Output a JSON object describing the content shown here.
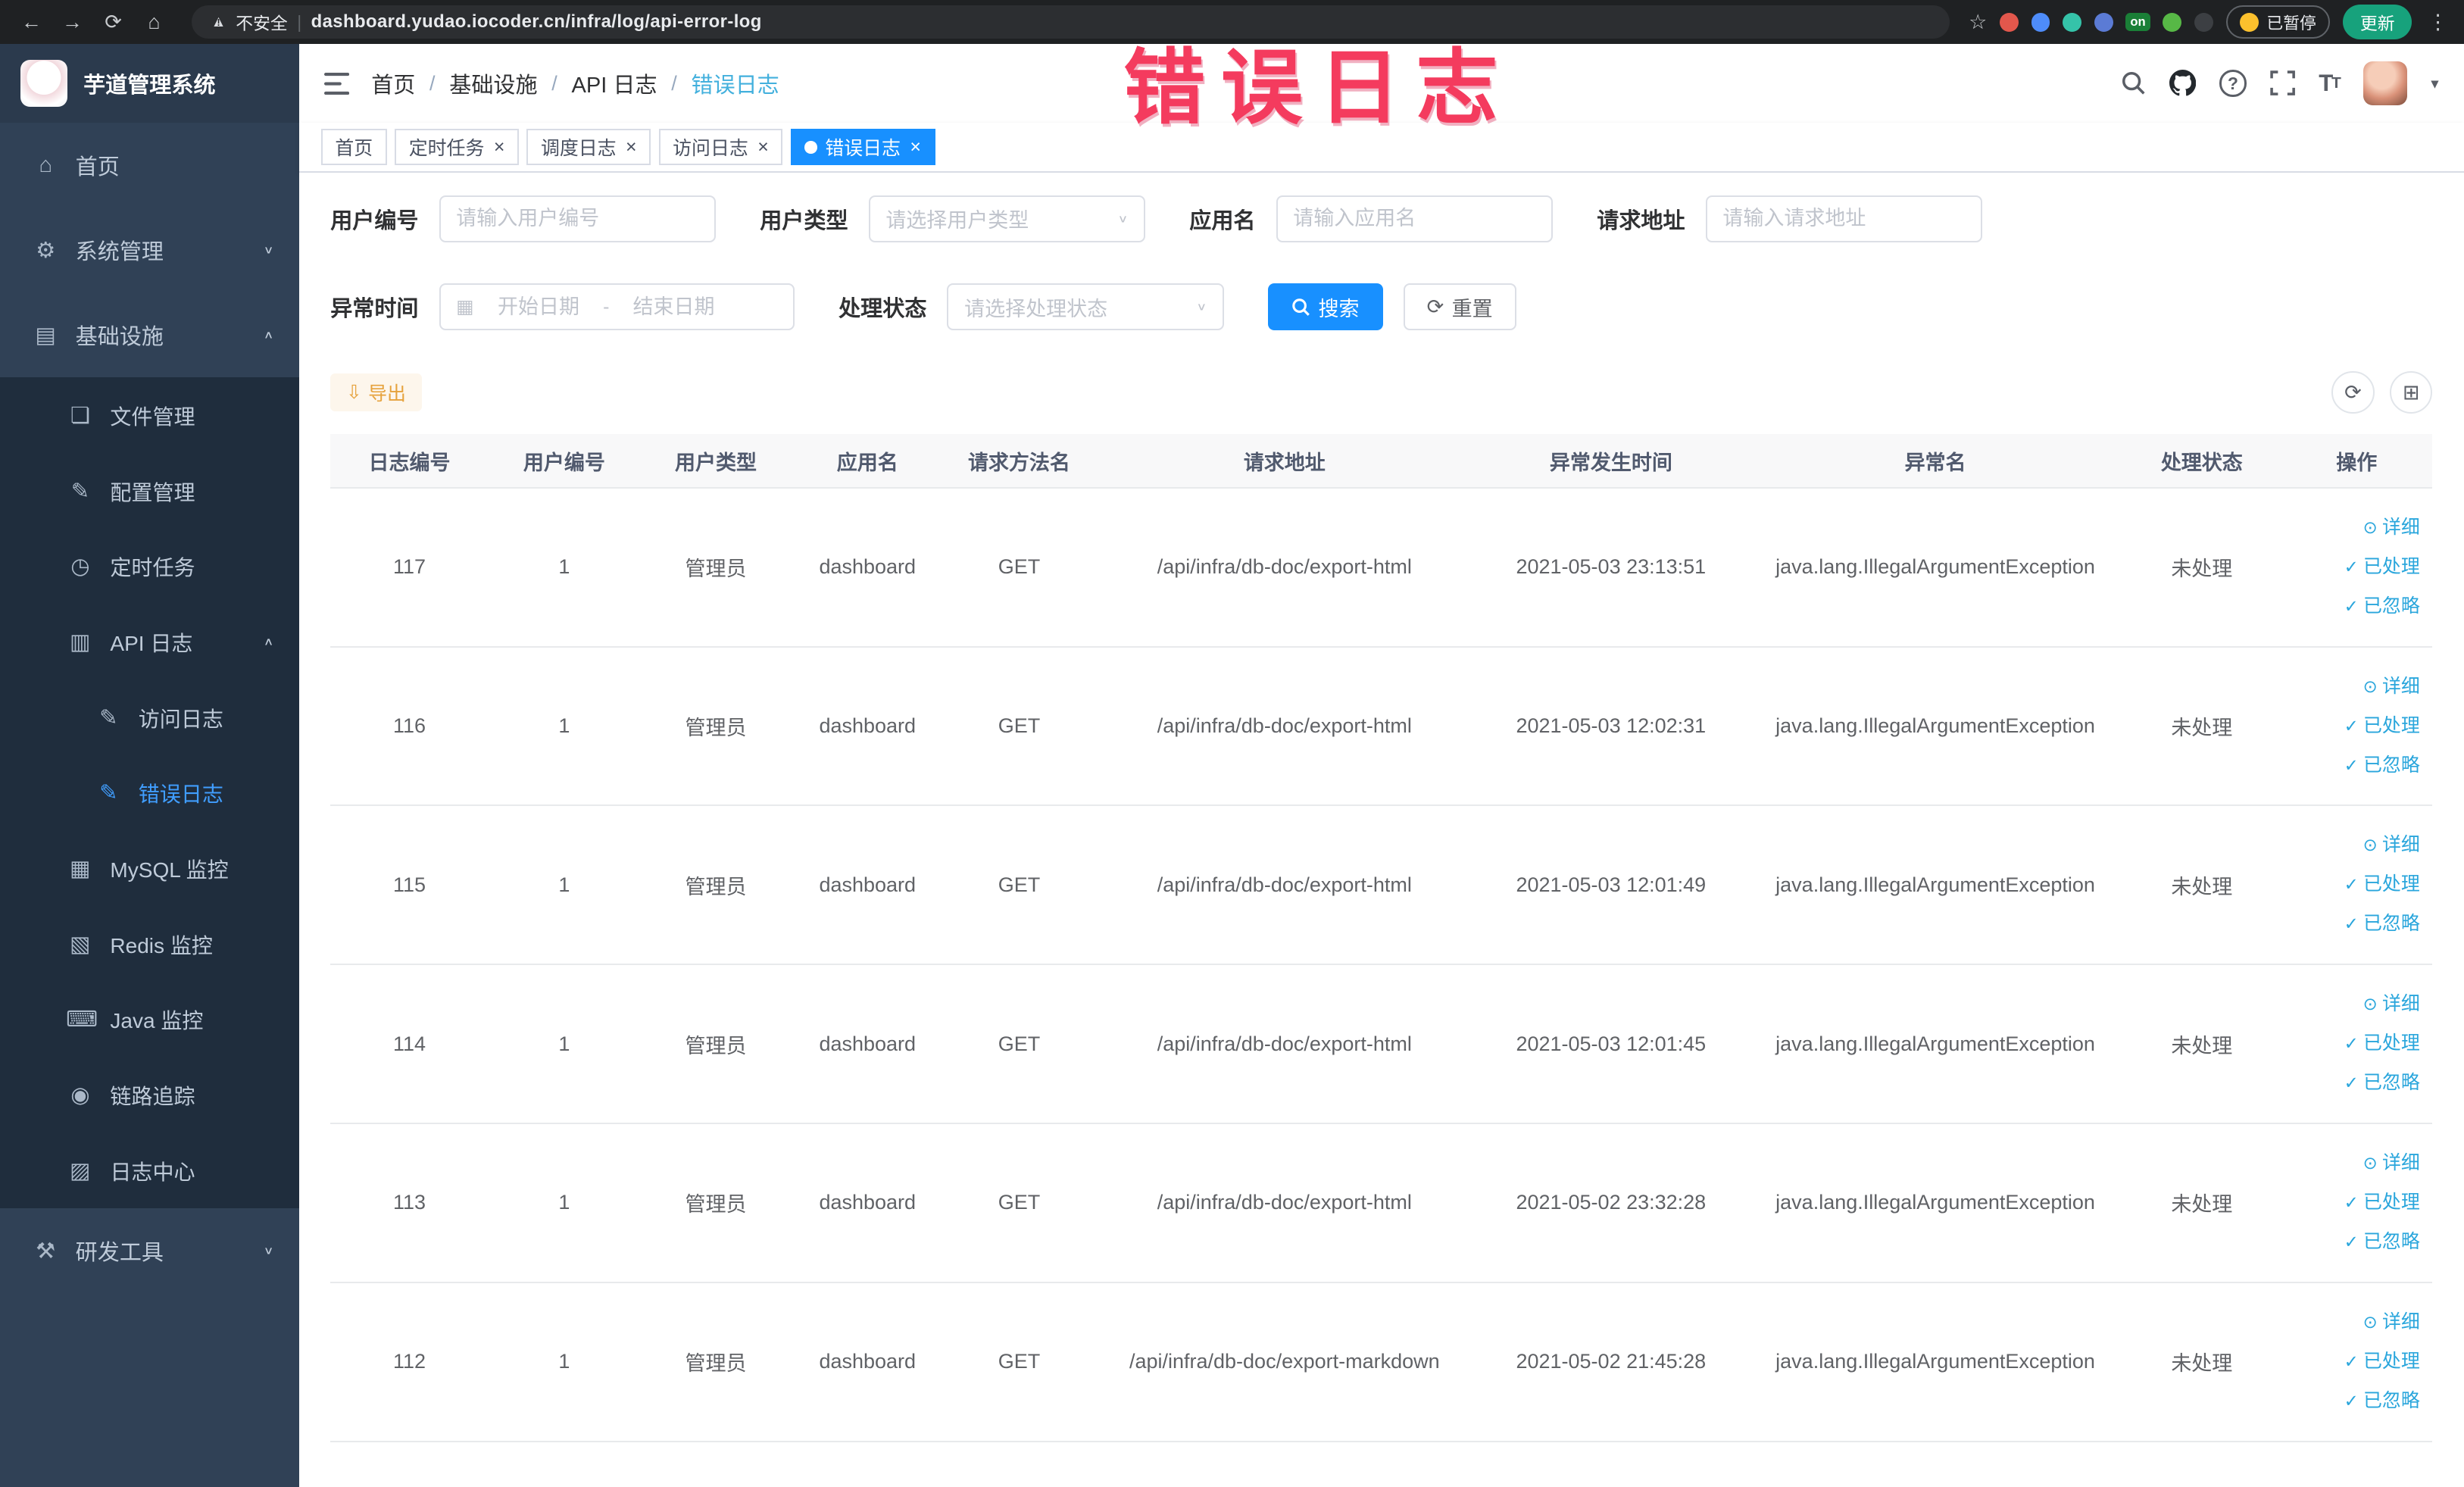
{
  "colors": {
    "primary": "#1890ff",
    "warning_button": "#e6a23c",
    "sidebar_bg": "#304156",
    "submenu_bg": "#1f2d3d",
    "sidebar_active": "#409eff",
    "link": "#2aa6dc",
    "watermark": "#f43b5e",
    "active_tab_bg": "#1890ff"
  },
  "annotation": {
    "watermark_text": "错误日志"
  },
  "browser": {
    "security_label": "不安全",
    "url": "dashboard.yudao.iocoder.cn/infra/log/api-error-log",
    "vpn_badge": "on",
    "paused_label": "已暂停",
    "update_label": "更新"
  },
  "sidebar": {
    "logo_title": "芋道管理系统",
    "items": [
      {
        "key": "home",
        "icon": "home-icon",
        "label": "首页",
        "level": 1
      },
      {
        "key": "system",
        "icon": "gear-icon",
        "label": "系统管理",
        "level": 1,
        "chevron": "down"
      },
      {
        "key": "infra",
        "icon": "infra-icon",
        "label": "基础设施",
        "level": 1,
        "chevron": "up"
      },
      {
        "key": "file",
        "icon": "file-icon",
        "label": "文件管理",
        "level": 2
      },
      {
        "key": "config",
        "icon": "config-icon",
        "label": "配置管理",
        "level": 2
      },
      {
        "key": "job",
        "icon": "timer-icon",
        "label": "定时任务",
        "level": 2
      },
      {
        "key": "api-log",
        "icon": "api-log-icon",
        "label": "API 日志",
        "level": 2,
        "chevron": "up"
      },
      {
        "key": "access-log",
        "icon": "edit-icon",
        "label": "访问日志",
        "level": 3
      },
      {
        "key": "error-log",
        "icon": "edit-icon",
        "label": "错误日志",
        "level": 3,
        "active": true
      },
      {
        "key": "mysql",
        "icon": "mysql-icon",
        "label": "MySQL 监控",
        "level": 2
      },
      {
        "key": "redis",
        "icon": "redis-icon",
        "label": "Redis 监控",
        "level": 2
      },
      {
        "key": "java",
        "icon": "java-icon",
        "label": "Java 监控",
        "level": 2
      },
      {
        "key": "trace",
        "icon": "trace-icon",
        "label": "链路追踪",
        "level": 2
      },
      {
        "key": "log-center",
        "icon": "log-center-icon",
        "label": "日志中心",
        "level": 2
      },
      {
        "key": "devtools",
        "icon": "tools-icon",
        "label": "研发工具",
        "level": 1,
        "chevron": "down"
      }
    ]
  },
  "header": {
    "breadcrumb": [
      "首页",
      "基础设施",
      "API 日志",
      "错误日志"
    ]
  },
  "tabs": [
    {
      "key": "home",
      "label": "首页",
      "closable": false,
      "active": false
    },
    {
      "key": "job",
      "label": "定时任务",
      "closable": true,
      "active": false
    },
    {
      "key": "job-log",
      "label": "调度日志",
      "closable": true,
      "active": false
    },
    {
      "key": "access-log",
      "label": "访问日志",
      "closable": true,
      "active": false
    },
    {
      "key": "error-log",
      "label": "错误日志",
      "closable": true,
      "active": true
    }
  ],
  "filters": {
    "user_id_label": "用户编号",
    "user_id_placeholder": "请输入用户编号",
    "user_type_label": "用户类型",
    "user_type_placeholder": "请选择用户类型",
    "app_name_label": "应用名",
    "app_name_placeholder": "请输入应用名",
    "request_url_label": "请求地址",
    "request_url_placeholder": "请输入请求地址",
    "time_label": "异常时间",
    "time_start_placeholder": "开始日期",
    "time_separator": "-",
    "time_end_placeholder": "结束日期",
    "status_label": "处理状态",
    "status_placeholder": "请选择处理状态",
    "search_label": "搜索",
    "reset_label": "重置"
  },
  "toolbar": {
    "export_label": "导出"
  },
  "table": {
    "headers": [
      "日志编号",
      "用户编号",
      "用户类型",
      "应用名",
      "请求方法名",
      "请求地址",
      "异常发生时间",
      "异常名",
      "处理状态",
      "操作"
    ],
    "action_labels": {
      "detail": "详细",
      "processed": "已处理",
      "ignore": "已忽略"
    },
    "rows": [
      {
        "log_id": "117",
        "user_id": "1",
        "user_type": "管理员",
        "app_name": "dashboard",
        "method": "GET",
        "request_url": "/api/infra/db-doc/export-html",
        "time": "2021-05-03 23:13:51",
        "exception": "java.lang.IllegalArgumentException",
        "status": "未处理"
      },
      {
        "log_id": "116",
        "user_id": "1",
        "user_type": "管理员",
        "app_name": "dashboard",
        "method": "GET",
        "request_url": "/api/infra/db-doc/export-html",
        "time": "2021-05-03 12:02:31",
        "exception": "java.lang.IllegalArgumentException",
        "status": "未处理"
      },
      {
        "log_id": "115",
        "user_id": "1",
        "user_type": "管理员",
        "app_name": "dashboard",
        "method": "GET",
        "request_url": "/api/infra/db-doc/export-html",
        "time": "2021-05-03 12:01:49",
        "exception": "java.lang.IllegalArgumentException",
        "status": "未处理"
      },
      {
        "log_id": "114",
        "user_id": "1",
        "user_type": "管理员",
        "app_name": "dashboard",
        "method": "GET",
        "request_url": "/api/infra/db-doc/export-html",
        "time": "2021-05-03 12:01:45",
        "exception": "java.lang.IllegalArgumentException",
        "status": "未处理"
      },
      {
        "log_id": "113",
        "user_id": "1",
        "user_type": "管理员",
        "app_name": "dashboard",
        "method": "GET",
        "request_url": "/api/infra/db-doc/export-html",
        "time": "2021-05-02 23:32:28",
        "exception": "java.lang.IllegalArgumentException",
        "status": "未处理"
      },
      {
        "log_id": "112",
        "user_id": "1",
        "user_type": "管理员",
        "app_name": "dashboard",
        "method": "GET",
        "request_url": "/api/infra/db-doc/export-markdown",
        "time": "2021-05-02 21:45:28",
        "exception": "java.lang.IllegalArgumentException",
        "status": "未处理"
      }
    ]
  }
}
